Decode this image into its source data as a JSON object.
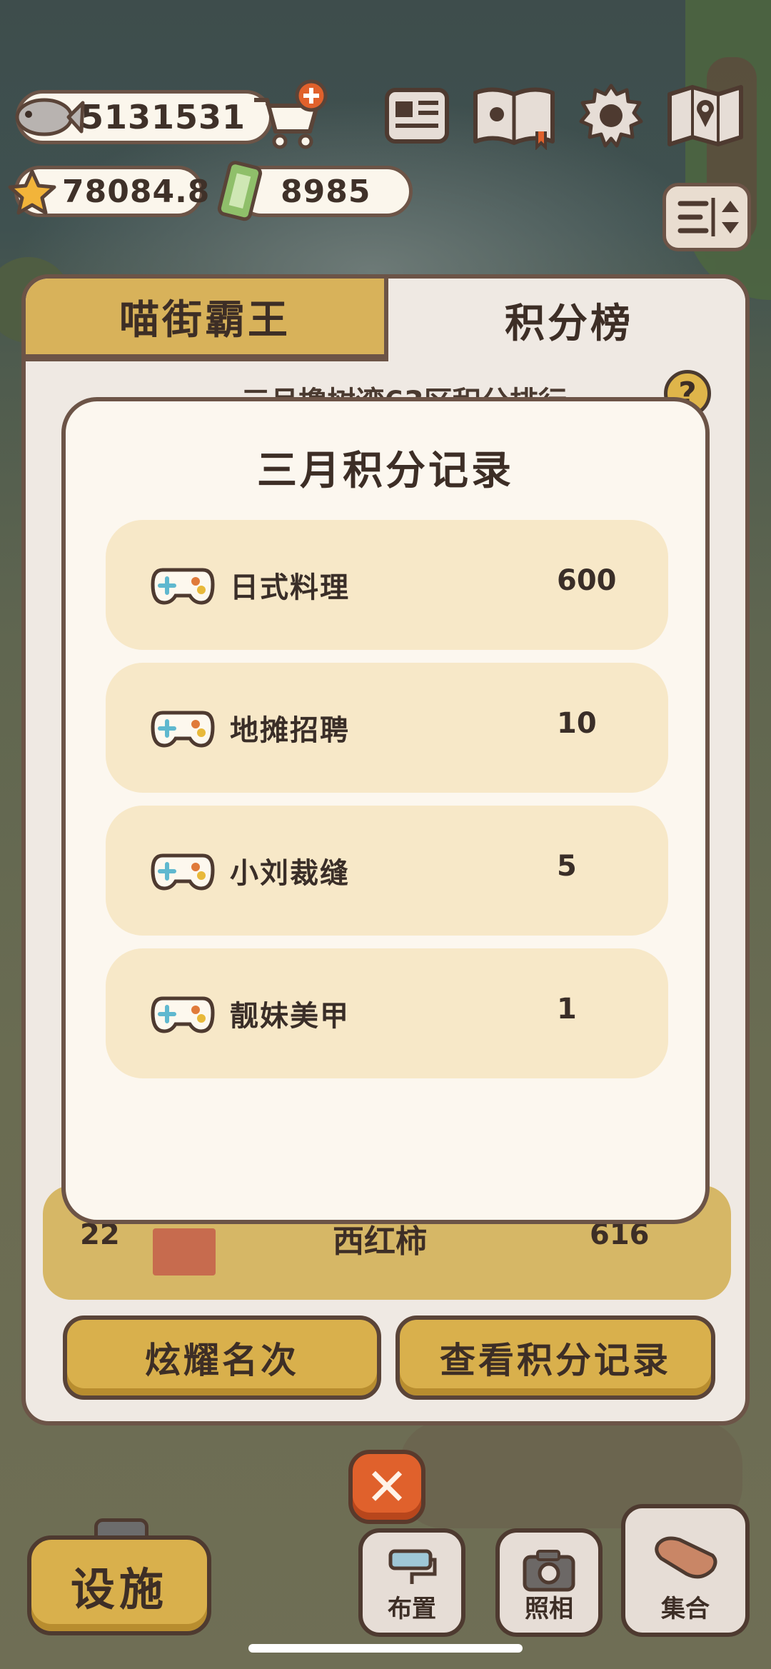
{
  "currency": {
    "fish": "5131531",
    "stars": "78084.8",
    "tickets": "8985"
  },
  "tabs": {
    "left": "喵街霸王",
    "right": "积分榜"
  },
  "panel": {
    "subtitle": "三月撸树湾63区积分排行",
    "help": "?"
  },
  "my_rank": {
    "rank": "22",
    "name": "西红柿",
    "score": "616"
  },
  "buttons": {
    "show_rank": "炫耀名次",
    "view_records": "查看积分记录",
    "close": "✕",
    "facility": "设施",
    "layout": "布置",
    "photo": "照相",
    "gather": "集合"
  },
  "dialog": {
    "title": "三月积分记录",
    "records": [
      {
        "name": "日式料理",
        "score": "600"
      },
      {
        "name": "地摊招聘",
        "score": "10"
      },
      {
        "name": "小刘裁缝",
        "score": "5"
      },
      {
        "name": "靓妹美甲",
        "score": "1"
      }
    ]
  },
  "colors": {
    "accent_gold": "#d9b04c",
    "border_brown": "#6c5447",
    "close_orange": "#e0612c",
    "record_bg": "#f7e8c8"
  }
}
